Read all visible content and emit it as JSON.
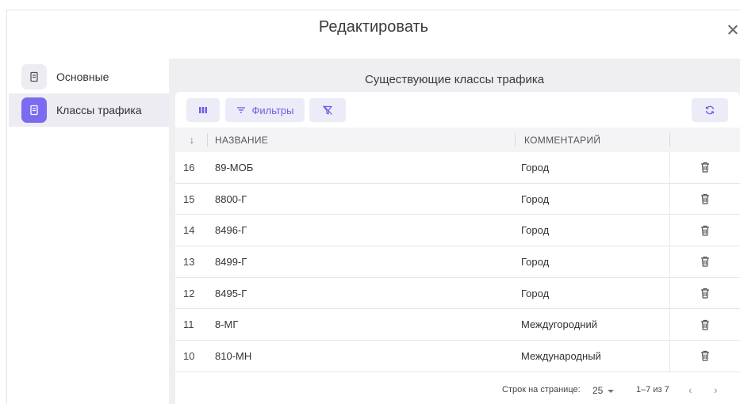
{
  "modal": {
    "title": "Редактировать"
  },
  "sidebar": {
    "items": [
      {
        "label": "Основные",
        "icon": "document-icon",
        "active": false
      },
      {
        "label": "Классы трафика",
        "icon": "document-icon",
        "active": true
      }
    ]
  },
  "section": {
    "title": "Существующие классы трафика"
  },
  "toolbar": {
    "filters_label": "Фильтры"
  },
  "table": {
    "columns": {
      "sort": "↓",
      "name": "НАЗВАНИЕ",
      "comment": "КОММЕНТАРИЙ"
    },
    "rows": [
      {
        "id": "16",
        "name": "89-МОБ",
        "comment": "Город"
      },
      {
        "id": "15",
        "name": "8800-Г",
        "comment": "Город"
      },
      {
        "id": "14",
        "name": "8496-Г",
        "comment": "Город"
      },
      {
        "id": "13",
        "name": "8499-Г",
        "comment": "Город"
      },
      {
        "id": "12",
        "name": "8495-Г",
        "comment": "Город"
      },
      {
        "id": "11",
        "name": "8-МГ",
        "comment": "Междугородний"
      },
      {
        "id": "10",
        "name": "810-МН",
        "comment": "Международный"
      }
    ]
  },
  "pager": {
    "rows_per_page_label": "Строк на странице:",
    "rows_per_page": "25",
    "range": "1–7 из 7",
    "prev": "‹",
    "next": "›"
  },
  "colors": {
    "accent": "#7b6bf2",
    "accent_light": "#ececf8",
    "panel_bg": "#efeff2"
  }
}
